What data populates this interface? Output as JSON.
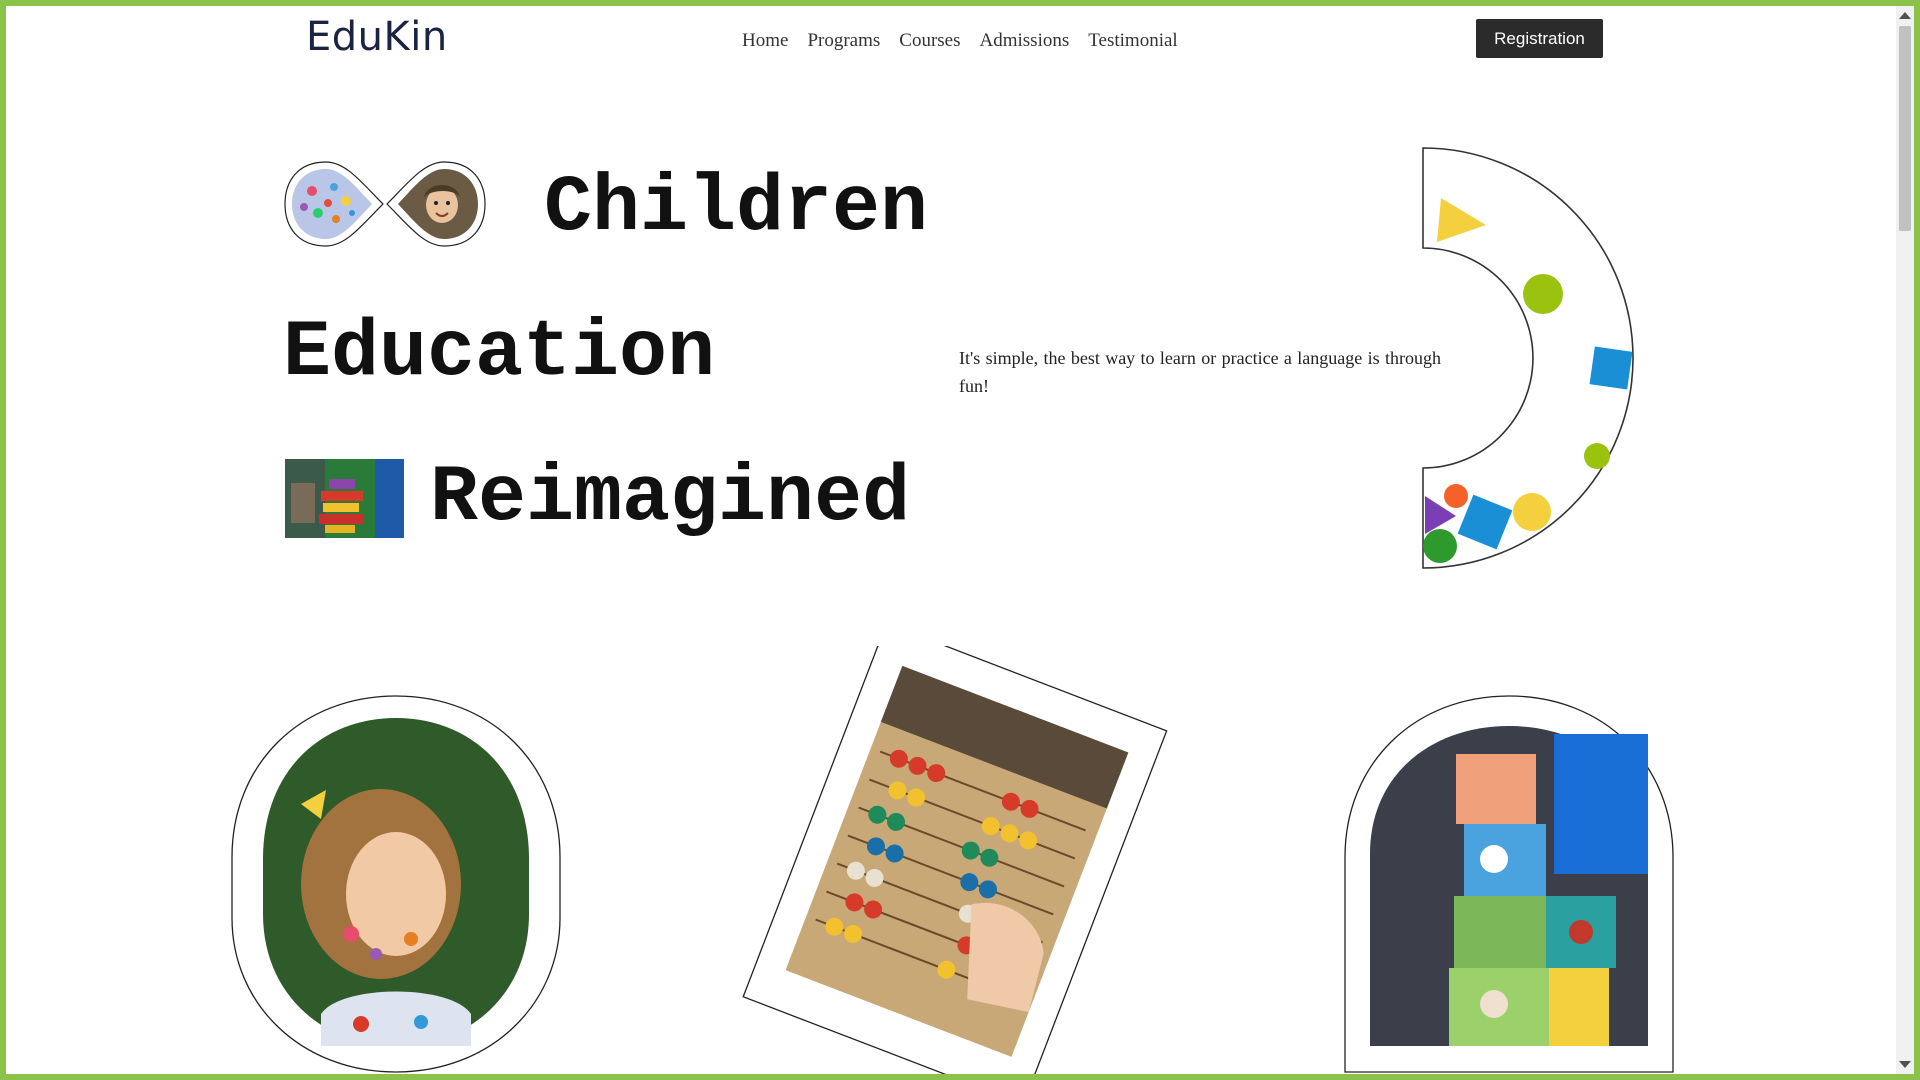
{
  "header": {
    "logo": "EduKin",
    "nav": [
      "Home",
      "Programs",
      "Courses",
      "Admissions",
      "Testimonial"
    ],
    "register_label": "Registration"
  },
  "hero": {
    "line1": "Children",
    "line2": "Education",
    "line3": "Reimagined",
    "description": "It's simple, the best way to learn or practice a language is through fun!"
  },
  "colors": {
    "page_border": "#8bc34a",
    "button_bg": "#2b2b2b",
    "logo_text": "#1c2340",
    "shape_yellow": "#f4d03f",
    "shape_green": "#9bc20e",
    "shape_blue": "#1a8fd6",
    "shape_purple": "#7b3fb5",
    "shape_orange": "#f4622a",
    "shape_darkgreen": "#2e9a2e"
  }
}
